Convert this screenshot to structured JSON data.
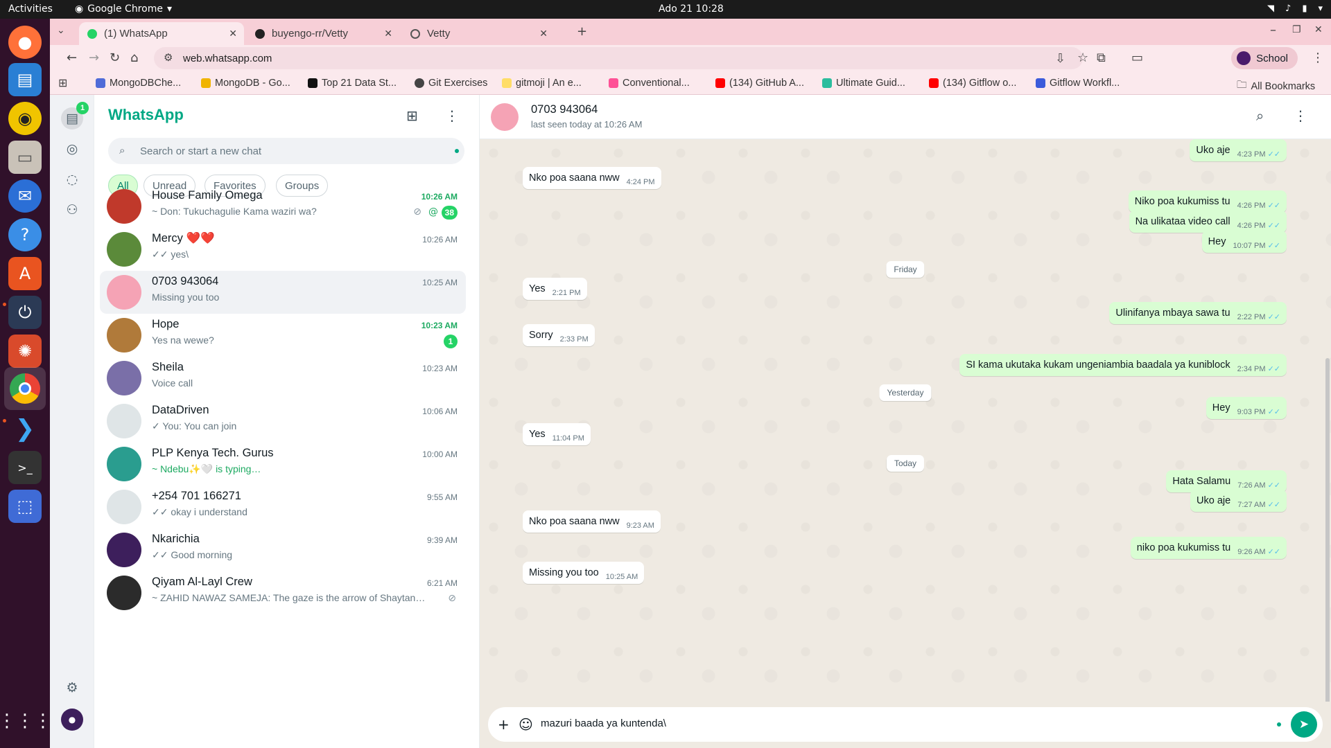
{
  "os": {
    "activities": "Activities",
    "app_name": "Google Chrome",
    "clock": "Ado 21  10:28"
  },
  "browser": {
    "tabs": [
      {
        "label": "(1) WhatsApp",
        "active": true
      },
      {
        "label": "buyengo-rr/Vetty",
        "active": false
      },
      {
        "label": "Vetty",
        "active": false
      }
    ],
    "url": "web.whatsapp.com",
    "profile": "School",
    "bookmarks": [
      "MongoDBChe...",
      "MongoDB - Go...",
      "Top 21 Data St...",
      "Git Exercises",
      "gitmoji | An e...",
      "Conventional...",
      "(134) GitHub A...",
      "Ultimate Guid...",
      "(134) Gitflow o...",
      "Gitflow Workfl..."
    ],
    "all_bookmarks": "All Bookmarks"
  },
  "whatsapp": {
    "rail": {
      "chats_badge": "1"
    },
    "list": {
      "title": "WhatsApp",
      "search_placeholder": "Search or start a new chat",
      "filters": [
        "All",
        "Unread",
        "Favorites",
        "Groups"
      ],
      "chats": [
        {
          "name": "House Family Omega",
          "time": "10:26 AM",
          "preview": "~ Don: Tukuchagulie Kama waziri wa?",
          "badge": "38",
          "unread": true,
          "avatar_color": "#c0392b"
        },
        {
          "name": "Mercy ❤️❤️",
          "time": "10:26 AM",
          "preview": "✓✓ yes\\",
          "badge": "",
          "unread": false,
          "avatar_color": "#5b8a3a"
        },
        {
          "name": "0703 943064",
          "time": "10:25 AM",
          "preview": "Missing you too",
          "badge": "",
          "unread": false,
          "avatar_color": "#f5a3b5"
        },
        {
          "name": "Hope",
          "time": "10:23 AM",
          "preview": "Yes na wewe?",
          "badge": "1",
          "unread": true,
          "avatar_color": "#b07a3a"
        },
        {
          "name": "Sheila",
          "time": "10:23 AM",
          "preview": "Voice call",
          "badge": "",
          "unread": false,
          "avatar_color": "#7a6fa8"
        },
        {
          "name": "DataDriven",
          "time": "10:06 AM",
          "preview": "✓ You: You can join",
          "badge": "",
          "unread": false,
          "avatar_color": "#dfe5e7"
        },
        {
          "name": "PLP Kenya Tech. Gurus",
          "time": "10:00 AM",
          "preview": "~ Ndebu✨🤍 is typing…",
          "badge": "",
          "unread": false,
          "avatar_color": "#2a9d8f"
        },
        {
          "name": "+254 701 166271",
          "time": "9:55 AM",
          "preview": "✓✓ okay i understand",
          "badge": "",
          "unread": false,
          "avatar_color": "#dfe5e7"
        },
        {
          "name": "Nkarichia",
          "time": "9:39 AM",
          "preview": "✓✓ Good morning",
          "badge": "",
          "unread": false,
          "avatar_color": "#3d1f5c"
        },
        {
          "name": "Qiyam Al-Layl Crew",
          "time": "6:21 AM",
          "preview": "~ ZAHID NAWAZ SAMEJA: The gaze is the arrow of Shaytan…",
          "badge": "",
          "unread": false,
          "avatar_color": "#2b2b2b"
        }
      ]
    },
    "conversation": {
      "name": "0703 943064",
      "status": "last seen today at 10:26 AM",
      "messages": [
        {
          "dir": "out",
          "text": "Uko aje",
          "time": "4:23 PM"
        },
        {
          "dir": "in",
          "text": "Nko poa saana nww",
          "time": "4:24 PM"
        },
        {
          "dir": "out",
          "text": "Niko poa kukumiss tu",
          "time": "4:26 PM"
        },
        {
          "dir": "out",
          "text": "Na ulikataa video call",
          "time": "4:26 PM"
        },
        {
          "dir": "out",
          "text": "Hey",
          "time": "10:07 PM"
        },
        {
          "dir": "day",
          "text": "Friday"
        },
        {
          "dir": "in",
          "text": "Yes",
          "time": "2:21 PM"
        },
        {
          "dir": "out",
          "text": "Ulinifanya mbaya sawa tu",
          "time": "2:22 PM"
        },
        {
          "dir": "in",
          "text": "Sorry",
          "time": "2:33 PM"
        },
        {
          "dir": "out",
          "text": "SI kama ukutaka kukam ungeniambia baadala ya kuniblock",
          "time": "2:34 PM"
        },
        {
          "dir": "day",
          "text": "Yesterday"
        },
        {
          "dir": "out",
          "text": "Hey",
          "time": "9:03 PM"
        },
        {
          "dir": "in",
          "text": "Yes",
          "time": "11:04 PM"
        },
        {
          "dir": "day",
          "text": "Today"
        },
        {
          "dir": "out",
          "text": "Hata Salamu",
          "time": "7:26 AM"
        },
        {
          "dir": "out",
          "text": "Uko aje",
          "time": "7:27 AM"
        },
        {
          "dir": "in",
          "text": "Nko poa saana nww",
          "time": "9:23 AM"
        },
        {
          "dir": "out",
          "text": "niko poa kukumiss tu",
          "time": "9:26 AM"
        },
        {
          "dir": "in",
          "text": "Missing you too",
          "time": "10:25 AM"
        }
      ],
      "composer_text": "mazuri baada ya kuntenda\\"
    }
  },
  "colors": {
    "accent": "#00a884",
    "outgoing_bubble": "#d9fdd3",
    "chat_bg": "#efeae2",
    "tab_strip": "#f7cfd7",
    "dock": "#30112a"
  }
}
